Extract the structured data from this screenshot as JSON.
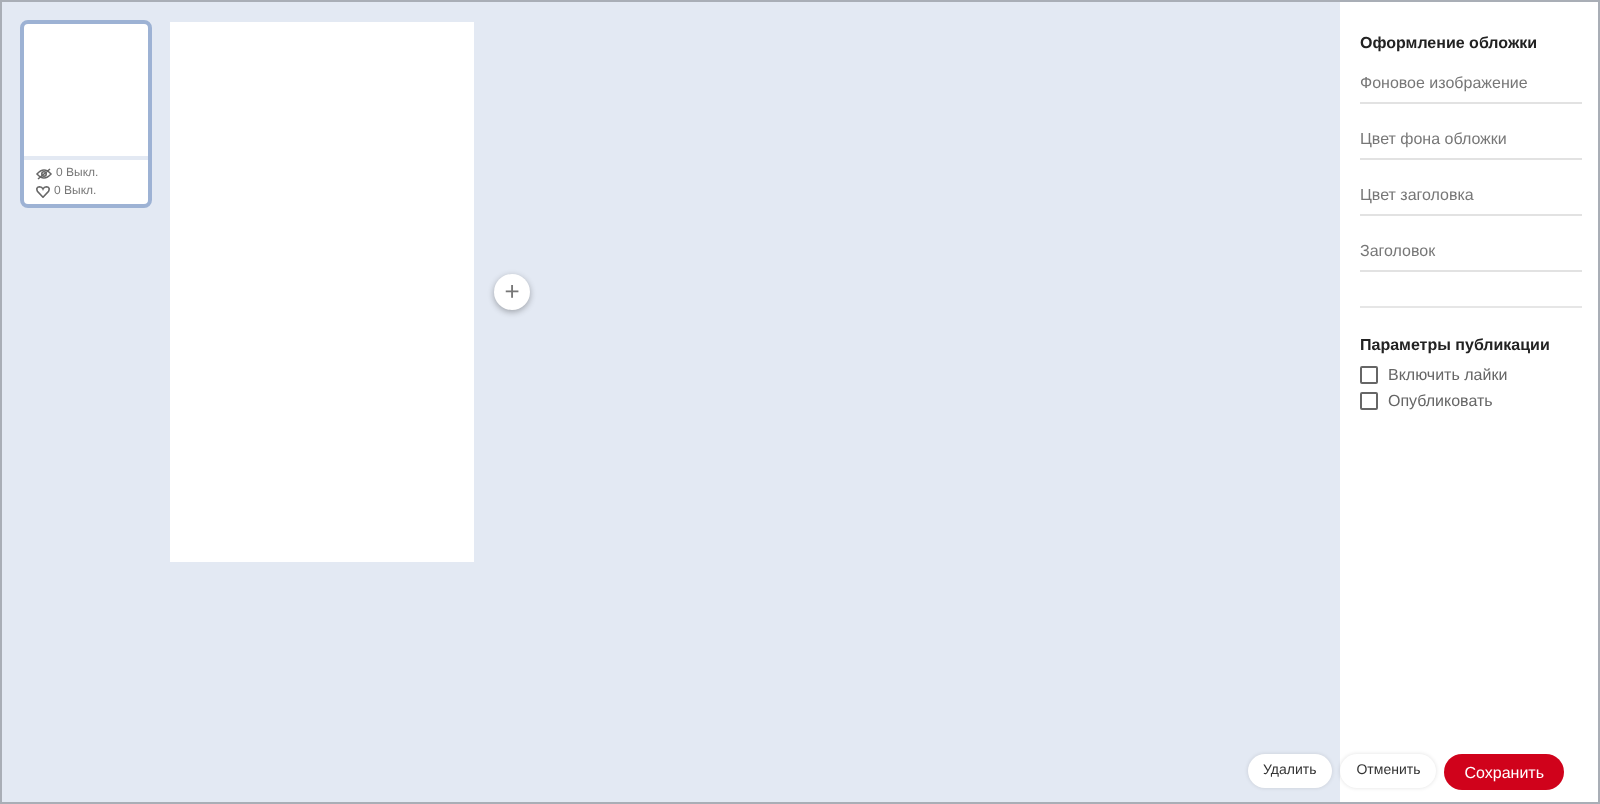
{
  "slides": [
    {
      "views": "0 Выкл.",
      "likes": "0 Выкл.",
      "selected": true
    }
  ],
  "add_button": "+",
  "cover_settings": {
    "title": "Оформление обложки",
    "fields": [
      {
        "placeholder": "Фоновое изображение"
      },
      {
        "placeholder": "Цвет фона обложки"
      },
      {
        "placeholder": "Цвет заголовка"
      },
      {
        "placeholder": "Заголовок"
      }
    ]
  },
  "publish_settings": {
    "title": "Параметры публикации",
    "options": [
      {
        "label": "Включить лайки",
        "checked": false
      },
      {
        "label": "Опубликовать",
        "checked": false
      }
    ]
  },
  "buttons": [
    {
      "label": "Удалить",
      "kind": "plain"
    },
    {
      "label": "Отменить",
      "kind": "plain"
    },
    {
      "label": "Сохранить",
      "kind": "primary"
    }
  ]
}
